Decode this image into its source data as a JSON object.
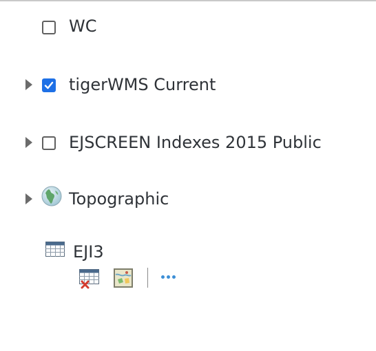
{
  "layers": [
    {
      "label": "WC",
      "checked": false,
      "expandable": false
    },
    {
      "label": "tigerWMS Current",
      "checked": true,
      "expandable": true
    },
    {
      "label": "EJSCREEN Indexes 2015 Public",
      "checked": false,
      "expandable": true
    },
    {
      "label": "Topographic",
      "type": "basemap",
      "expandable": true
    }
  ],
  "table": {
    "label": "EJI3",
    "actions": [
      "remove-table-icon",
      "map-icon",
      "more-options-icon"
    ]
  },
  "colors": {
    "accent": "#1e70e6",
    "text": "#2f3338",
    "dots": "#3d8fd6"
  }
}
